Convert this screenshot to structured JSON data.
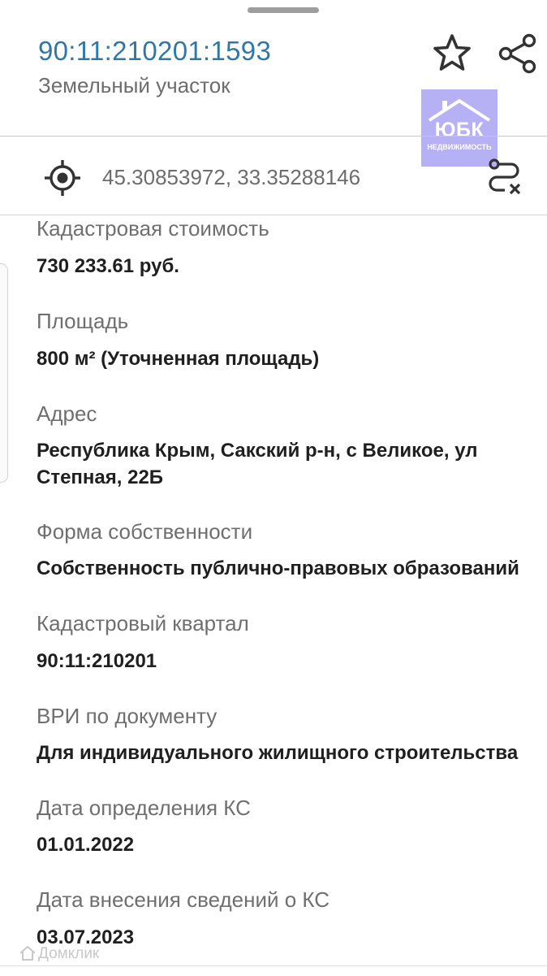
{
  "header": {
    "cadastral_number": "90:11:210201:1593",
    "object_type": "Земельный участок"
  },
  "actions": {
    "favorite_icon": "star-outline-icon",
    "share_icon": "share-icon",
    "route_icon": "route-icon"
  },
  "watermark": {
    "brand": "ЮБК",
    "tagline": "НЕДВИЖИМОСТЬ",
    "color": "#b6b1f4"
  },
  "location": {
    "icon": "crosshair-icon",
    "coordinates": "45.30853972, 33.35288146"
  },
  "fields": [
    {
      "label": "Кадастровая стоимость",
      "value": "730 233.61 руб."
    },
    {
      "label": "Площадь",
      "value": "800 м² (Уточненная площадь)"
    },
    {
      "label": "Адрес",
      "value": "Республика Крым, Сакский р-н, с Великое, ул Степная, 22Б"
    },
    {
      "label": "Форма собственности",
      "value": "Собственность публично-правовых образований"
    },
    {
      "label": "Кадастровый квартал",
      "value": "90:11:210201"
    },
    {
      "label": "ВРИ по документу",
      "value": "Для индивидуального жилищного строительства"
    },
    {
      "label": "Дата определения КС",
      "value": "01.01.2022"
    },
    {
      "label": "Дата внесения сведений о КС",
      "value": "03.07.2023"
    }
  ],
  "footer": {
    "source_watermark": "Домклик"
  },
  "colors": {
    "accent": "#2f78a6",
    "label": "#6f6f6f",
    "value": "#1f1f1f"
  }
}
